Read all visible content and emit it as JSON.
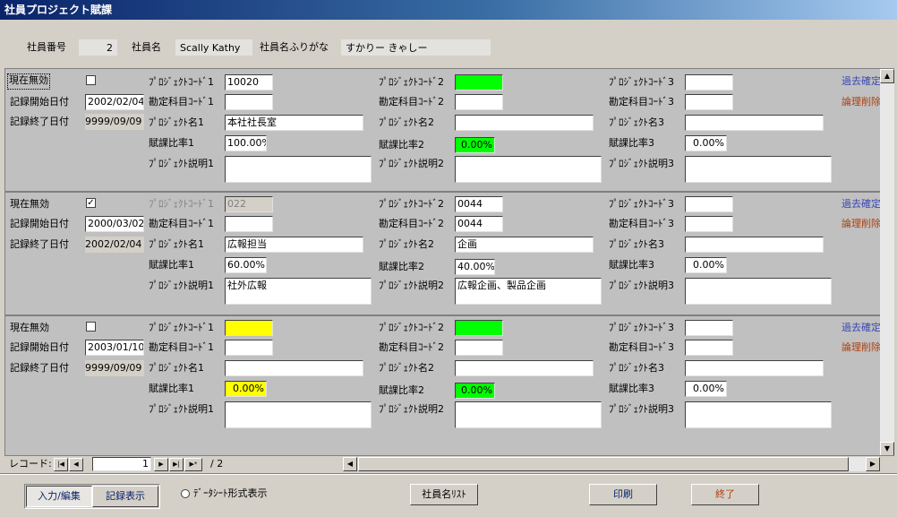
{
  "window": {
    "title": "社員プロジェクト賦課"
  },
  "header": {
    "emp_no_label": "社員番号",
    "emp_no": "2",
    "emp_name_label": "社員名",
    "emp_name": "Scally Kathy",
    "emp_kana_label": "社員名ふりがな",
    "emp_kana": "すかりー きゃしー"
  },
  "labels": {
    "current_invalid": "現在無効",
    "start_date": "記録開始日付",
    "end_date": "記録終了日付",
    "pc1": "ﾌﾟﾛｼﾞｪｸﾄｺｰﾄﾞ1",
    "ac1": "勘定科目ｺｰﾄﾞ1",
    "pn1": "ﾌﾟﾛｼﾞｪｸﾄ名1",
    "r1": "賦課比率1",
    "pd1": "ﾌﾟﾛｼﾞｪｸﾄ説明1",
    "pc2": "ﾌﾟﾛｼﾞｪｸﾄｺｰﾄﾞ2",
    "ac2": "勘定科目ｺｰﾄﾞ2",
    "pn2": "ﾌﾟﾛｼﾞｪｸﾄ名2",
    "r2": "賦課比率2",
    "pd2": "ﾌﾟﾛｼﾞｪｸﾄ説明2",
    "pc3": "ﾌﾟﾛｼﾞｪｸﾄｺｰﾄﾞ3",
    "ac3": "勘定科目ｺｰﾄﾞ3",
    "pn3": "ﾌﾟﾛｼﾞｪｸﾄ名3",
    "r3": "賦課比率3",
    "pd3": "ﾌﾟﾛｼﾞｪｸﾄ説明3",
    "past_confirm": "過去確定",
    "logical_delete": "論理削除"
  },
  "records": [
    {
      "invalid": false,
      "start": "2002/02/04",
      "end": "9999/09/09",
      "pc1": "10020",
      "ac1": "",
      "pn1": "本社社長室",
      "r1": "100.00%",
      "pd1": "",
      "pc2": "",
      "ac2": "",
      "pn2": "",
      "r2": "0.00%",
      "pd2": "",
      "pc3": "",
      "ac3": "",
      "pn3": "",
      "r3": "0.00%",
      "pd3": ""
    },
    {
      "invalid": true,
      "start": "2000/03/02",
      "end": "2002/02/04",
      "pc1": "022",
      "ac1": "",
      "pn1": "広報担当",
      "r1": "60.00%",
      "pd1": "社外広報",
      "pc2": "0044",
      "ac2": "0044",
      "pn2": "企画",
      "r2": "40.00%",
      "pd2": "広報企画、製品企画",
      "pc3": "",
      "ac3": "",
      "pn3": "",
      "r3": "0.00%",
      "pd3": ""
    },
    {
      "invalid": false,
      "start": "2003/01/10",
      "end": "9999/09/09",
      "pc1": "",
      "ac1": "",
      "pn1": "",
      "r1": "0.00%",
      "pd1": "",
      "pc2": "",
      "ac2": "",
      "pn2": "",
      "r2": "0.00%",
      "pd2": "",
      "pc3": "",
      "ac3": "",
      "pn3": "",
      "r3": "0.00%",
      "pd3": ""
    }
  ],
  "nav": {
    "label": "レコード:",
    "current": "1",
    "total": "/ 2"
  },
  "footer": {
    "input_edit": "入力/編集",
    "record_view": "記録表示",
    "datasheet": "ﾃﾞｰﾀｼｰﾄ形式表示",
    "emp_list": "社員名ﾘｽﾄ",
    "print": "印刷",
    "close": "終了"
  },
  "colors": {
    "highlight_green": "#00ff00",
    "highlight_yellow": "#ffff00",
    "link_blue": "#3a49b5",
    "link_red": "#b04010"
  }
}
